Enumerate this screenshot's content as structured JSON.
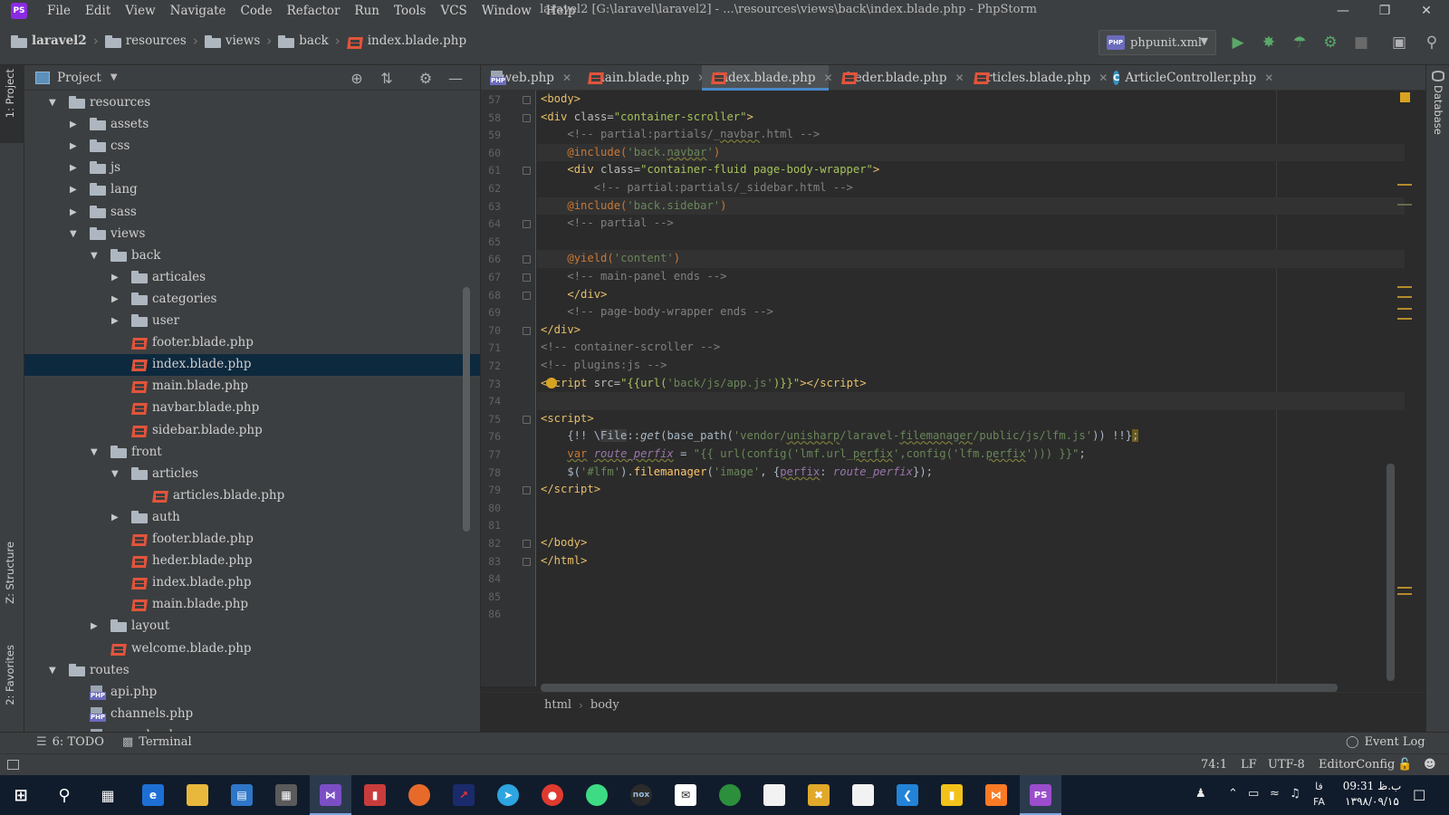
{
  "app": {
    "menu": [
      "File",
      "Edit",
      "View",
      "Navigate",
      "Code",
      "Refactor",
      "Run",
      "Tools",
      "VCS",
      "Window",
      "Help"
    ],
    "window_title": "laravel2 [G:\\laravel\\laravel2] - ...\\resources\\views\\back\\index.blade.php - PhpStorm",
    "logo_text": "PS"
  },
  "breadcrumb": [
    "laravel2",
    "resources",
    "views",
    "back",
    "index.blade.php"
  ],
  "toolbar": {
    "run_config": "phpunit.xml",
    "php_badge": "PHP"
  },
  "left_strip": {
    "project_tab": "1: Project",
    "structure_tab": "Z: Structure",
    "favorites_tab": "2: Favorites"
  },
  "right_strip": {
    "database_tab": "Database"
  },
  "project_panel": {
    "title": "Project",
    "tree": [
      {
        "label": "resources",
        "type": "folder",
        "depth": 0,
        "expanded": true
      },
      {
        "label": "assets",
        "type": "folder",
        "depth": 1,
        "expanded": false
      },
      {
        "label": "css",
        "type": "folder",
        "depth": 1,
        "expanded": false
      },
      {
        "label": "js",
        "type": "folder",
        "depth": 1,
        "expanded": false
      },
      {
        "label": "lang",
        "type": "folder",
        "depth": 1,
        "expanded": false
      },
      {
        "label": "sass",
        "type": "folder",
        "depth": 1,
        "expanded": false
      },
      {
        "label": "views",
        "type": "folder",
        "depth": 1,
        "expanded": true
      },
      {
        "label": "back",
        "type": "folder",
        "depth": 2,
        "expanded": true
      },
      {
        "label": "articales",
        "type": "folder",
        "depth": 3,
        "expanded": false
      },
      {
        "label": "categories",
        "type": "folder",
        "depth": 3,
        "expanded": false
      },
      {
        "label": "user",
        "type": "folder",
        "depth": 3,
        "expanded": false
      },
      {
        "label": "footer.blade.php",
        "type": "blade",
        "depth": 3
      },
      {
        "label": "index.blade.php",
        "type": "blade",
        "depth": 3,
        "selected": true
      },
      {
        "label": "main.blade.php",
        "type": "blade",
        "depth": 3
      },
      {
        "label": "navbar.blade.php",
        "type": "blade",
        "depth": 3
      },
      {
        "label": "sidebar.blade.php",
        "type": "blade",
        "depth": 3
      },
      {
        "label": "front",
        "type": "folder",
        "depth": 2,
        "expanded": true
      },
      {
        "label": "articles",
        "type": "folder",
        "depth": 3,
        "expanded": true
      },
      {
        "label": "articles.blade.php",
        "type": "blade",
        "depth": 4
      },
      {
        "label": "auth",
        "type": "folder",
        "depth": 3,
        "expanded": false
      },
      {
        "label": "footer.blade.php",
        "type": "blade",
        "depth": 3
      },
      {
        "label": "heder.blade.php",
        "type": "blade",
        "depth": 3
      },
      {
        "label": "index.blade.php",
        "type": "blade",
        "depth": 3
      },
      {
        "label": "main.blade.php",
        "type": "blade",
        "depth": 3
      },
      {
        "label": "layout",
        "type": "folder",
        "depth": 2,
        "expanded": false
      },
      {
        "label": "welcome.blade.php",
        "type": "blade",
        "depth": 2
      },
      {
        "label": "routes",
        "type": "folder",
        "depth": 0,
        "expanded": true
      },
      {
        "label": "api.php",
        "type": "php",
        "depth": 1
      },
      {
        "label": "channels.php",
        "type": "php",
        "depth": 1
      },
      {
        "label": "console.php",
        "type": "php",
        "depth": 1
      }
    ]
  },
  "editor_tabs": [
    {
      "label": "web.php",
      "icon": "php"
    },
    {
      "label": "main.blade.php",
      "icon": "blade"
    },
    {
      "label": "index.blade.php",
      "icon": "blade",
      "active": true
    },
    {
      "label": "heder.blade.php",
      "icon": "blade"
    },
    {
      "label": "articles.blade.php",
      "icon": "blade"
    },
    {
      "label": "ArticleController.php",
      "icon": "class"
    }
  ],
  "editor": {
    "line_numbers": [
      "57",
      "58",
      "59",
      "60",
      "61",
      "62",
      "63",
      "64",
      "65",
      "66",
      "67",
      "68",
      "69",
      "70",
      "71",
      "72",
      "73",
      "74",
      "75",
      "76",
      "77",
      "78",
      "79",
      "80",
      "81",
      "82",
      "83",
      "84",
      "85",
      "86"
    ],
    "breadcrumb": [
      "html",
      "body"
    ]
  },
  "bottom_tools": {
    "todo": "6: TODO",
    "terminal": "Terminal",
    "event_log": "Event Log"
  },
  "status": {
    "position": "74:1",
    "line_sep": "LF",
    "encoding": "UTF-8",
    "editor_config": "EditorConfig"
  },
  "taskbar": {
    "lang": "FA",
    "lang_top": "فا",
    "time": "09:31 ب.ظ",
    "date": "۱۳۹۸/۰۹/۱۵"
  }
}
